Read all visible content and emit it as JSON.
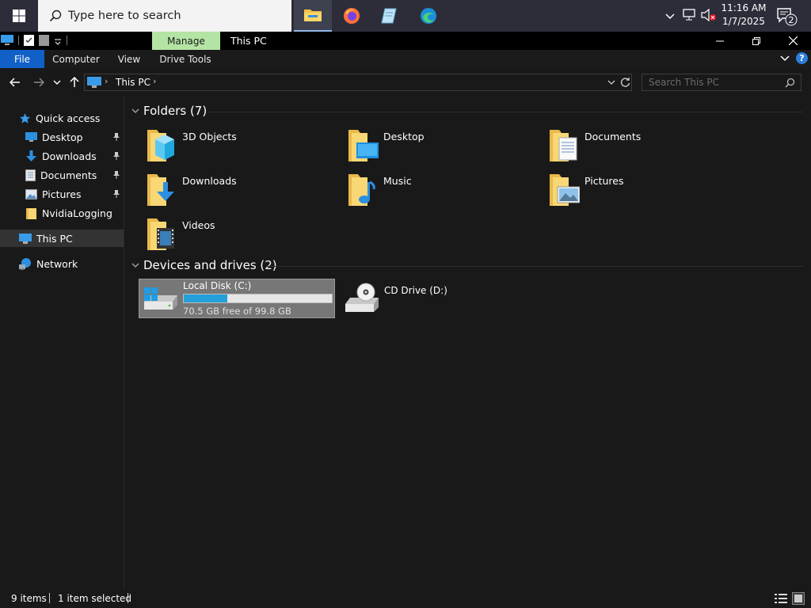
{
  "taskbar": {
    "search_placeholder": "Type here to search",
    "apps": [
      "file-explorer-icon",
      "firefox-icon",
      "notepad-icon",
      "edge-icon"
    ],
    "clock_time": "11:16 AM",
    "clock_date": "1/7/2025",
    "notification_count": "2"
  },
  "window": {
    "title": "This PC",
    "manage_tab": "Manage"
  },
  "ribbon": {
    "tabs": [
      "File",
      "Computer",
      "View",
      "Drive Tools"
    ],
    "help": "?"
  },
  "address": {
    "path": [
      "This PC"
    ],
    "search_placeholder": "Search This PC"
  },
  "sidebar": {
    "quick_access": "Quick access",
    "items": [
      {
        "label": "Desktop",
        "icon": "desktop-icon",
        "pinned": true
      },
      {
        "label": "Downloads",
        "icon": "downloads-icon",
        "pinned": true
      },
      {
        "label": "Documents",
        "icon": "documents-icon",
        "pinned": true
      },
      {
        "label": "Pictures",
        "icon": "pictures-icon",
        "pinned": true
      },
      {
        "label": "NvidiaLogging",
        "icon": "folder-icon",
        "pinned": false
      }
    ],
    "this_pc": "This PC",
    "network": "Network"
  },
  "folders": {
    "header": "Folders (7)",
    "items": [
      {
        "label": "3D Objects",
        "icon": "3d-objects-icon"
      },
      {
        "label": "Desktop",
        "icon": "desktop-icon"
      },
      {
        "label": "Documents",
        "icon": "documents-icon"
      },
      {
        "label": "Downloads",
        "icon": "downloads-icon"
      },
      {
        "label": "Music",
        "icon": "music-icon"
      },
      {
        "label": "Pictures",
        "icon": "pictures-icon"
      },
      {
        "label": "Videos",
        "icon": "videos-icon"
      }
    ]
  },
  "drives": {
    "header": "Devices and drives (2)",
    "items": [
      {
        "label": "Local Disk (C:)",
        "free_text": "70.5 GB free of 99.8 GB",
        "used_fraction": 0.294
      },
      {
        "label": "CD Drive (D:)"
      }
    ]
  },
  "status": {
    "items_count": "9 items",
    "selected": "1 item selected"
  },
  "colors": {
    "accent": "#1160c8",
    "manage_tab": "#b4e4a4",
    "drive_bar": "#26a0da",
    "selection": "#777777"
  }
}
